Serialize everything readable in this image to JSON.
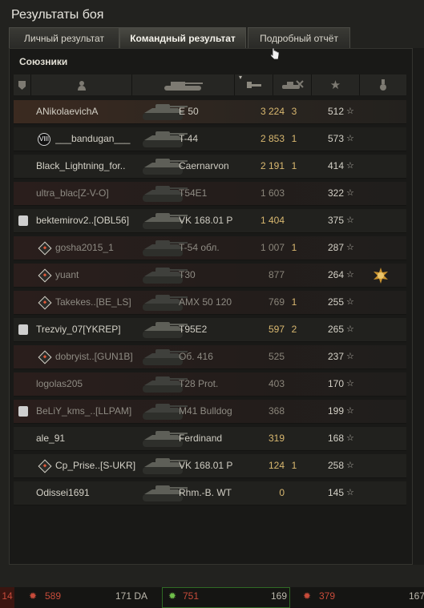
{
  "window": {
    "title": "Результаты боя",
    "tabs": [
      {
        "label": "Личный результат",
        "active": false
      },
      {
        "label": "Командный результат",
        "active": true
      },
      {
        "label": "Подробный отчёт",
        "active": false
      }
    ]
  },
  "team": {
    "title": "Союзники",
    "header_icons": [
      "platoon-icon",
      "player-icon",
      "tank-icon",
      "damage-icon",
      "kills-icon",
      "xp-star-icon",
      "medal-icon"
    ]
  },
  "players": [
    {
      "name": "ANikolaevichA",
      "tank": "E 50",
      "damage": "3 224",
      "kills": "3",
      "xp": "512",
      "style": "player",
      "dim": false,
      "badge": "none",
      "medal": false
    },
    {
      "name": "___bandugan___",
      "tank": "T-44",
      "damage": "2 853",
      "kills": "1",
      "xp": "573",
      "style": "alt",
      "dim": false,
      "badge": "rank",
      "rank_text": "VIII",
      "medal": false
    },
    {
      "name": "Black_Lightning_for..",
      "tank": "Caernarvon",
      "damage": "2 191",
      "kills": "1",
      "xp": "414",
      "style": "normal",
      "dim": false,
      "badge": "none",
      "medal": false
    },
    {
      "name": "ultra_blac[Z-V-O]",
      "tank": "T54E1",
      "damage": "1 603",
      "kills": "",
      "xp": "322",
      "style": "dead",
      "dim": true,
      "badge": "none",
      "medal": false
    },
    {
      "name": "bektemirov2..[OBL56]",
      "tank": "VK 168.01 P",
      "damage": "1 404",
      "kills": "",
      "xp": "375",
      "style": "normal",
      "dim": false,
      "badge": "platoon",
      "medal": false
    },
    {
      "name": "gosha2015_1",
      "tank": "T-54 обл.",
      "damage": "1 007",
      "kills": "1",
      "xp": "287",
      "style": "dead",
      "dim": true,
      "badge": "diamond",
      "medal": false
    },
    {
      "name": "yuant",
      "tank": "T30",
      "damage": "877",
      "kills": "",
      "xp": "264",
      "style": "dead",
      "dim": true,
      "badge": "diamond",
      "medal": true
    },
    {
      "name": "Takekes..[BE_LS]",
      "tank": "AMX 50 120",
      "damage": "769",
      "kills": "1",
      "xp": "255",
      "style": "dead",
      "dim": true,
      "badge": "diamond",
      "medal": false
    },
    {
      "name": "Trezviy_07[YKREP]",
      "tank": "T95E2",
      "damage": "597",
      "kills": "2",
      "xp": "265",
      "style": "normal",
      "dim": false,
      "badge": "platoon",
      "medal": false
    },
    {
      "name": "dobryist..[GUN1B]",
      "tank": "Об. 416",
      "damage": "525",
      "kills": "",
      "xp": "237",
      "style": "dead",
      "dim": true,
      "badge": "diamond",
      "medal": false
    },
    {
      "name": "logolas205",
      "tank": "T28 Prot.",
      "damage": "403",
      "kills": "",
      "xp": "170",
      "style": "dead",
      "dim": true,
      "badge": "none",
      "medal": false
    },
    {
      "name": "BeLiY_kms_..[LLPAM]",
      "tank": "M41 Bulldog",
      "damage": "368",
      "kills": "",
      "xp": "199",
      "style": "dead",
      "dim": true,
      "badge": "platoon",
      "medal": false
    },
    {
      "name": "ale_91",
      "tank": "Ferdinand",
      "damage": "319",
      "kills": "",
      "xp": "168",
      "style": "normal",
      "dim": false,
      "badge": "none",
      "medal": false
    },
    {
      "name": "Cp_Prise..[S-UKR]",
      "tank": "VK 168.01 P",
      "damage": "124",
      "kills": "1",
      "xp": "258",
      "style": "normal",
      "dim": false,
      "badge": "diamond",
      "medal": false
    },
    {
      "name": "Odissei1691",
      "tank": "Rhm.-B. WT",
      "damage": "0",
      "kills": "",
      "xp": "145",
      "style": "normal",
      "dim": false,
      "badge": "none",
      "medal": false
    }
  ],
  "bottom_bar": {
    "left_num": "14",
    "item1": "589",
    "item1_value": "171 DA",
    "item2": "751",
    "item2_value": "169",
    "item3": "379",
    "item3_value": "167"
  },
  "colors": {
    "accent_damage": "#d9b870",
    "text": "#d4d1c7",
    "dim_text": "#8e8b83"
  }
}
